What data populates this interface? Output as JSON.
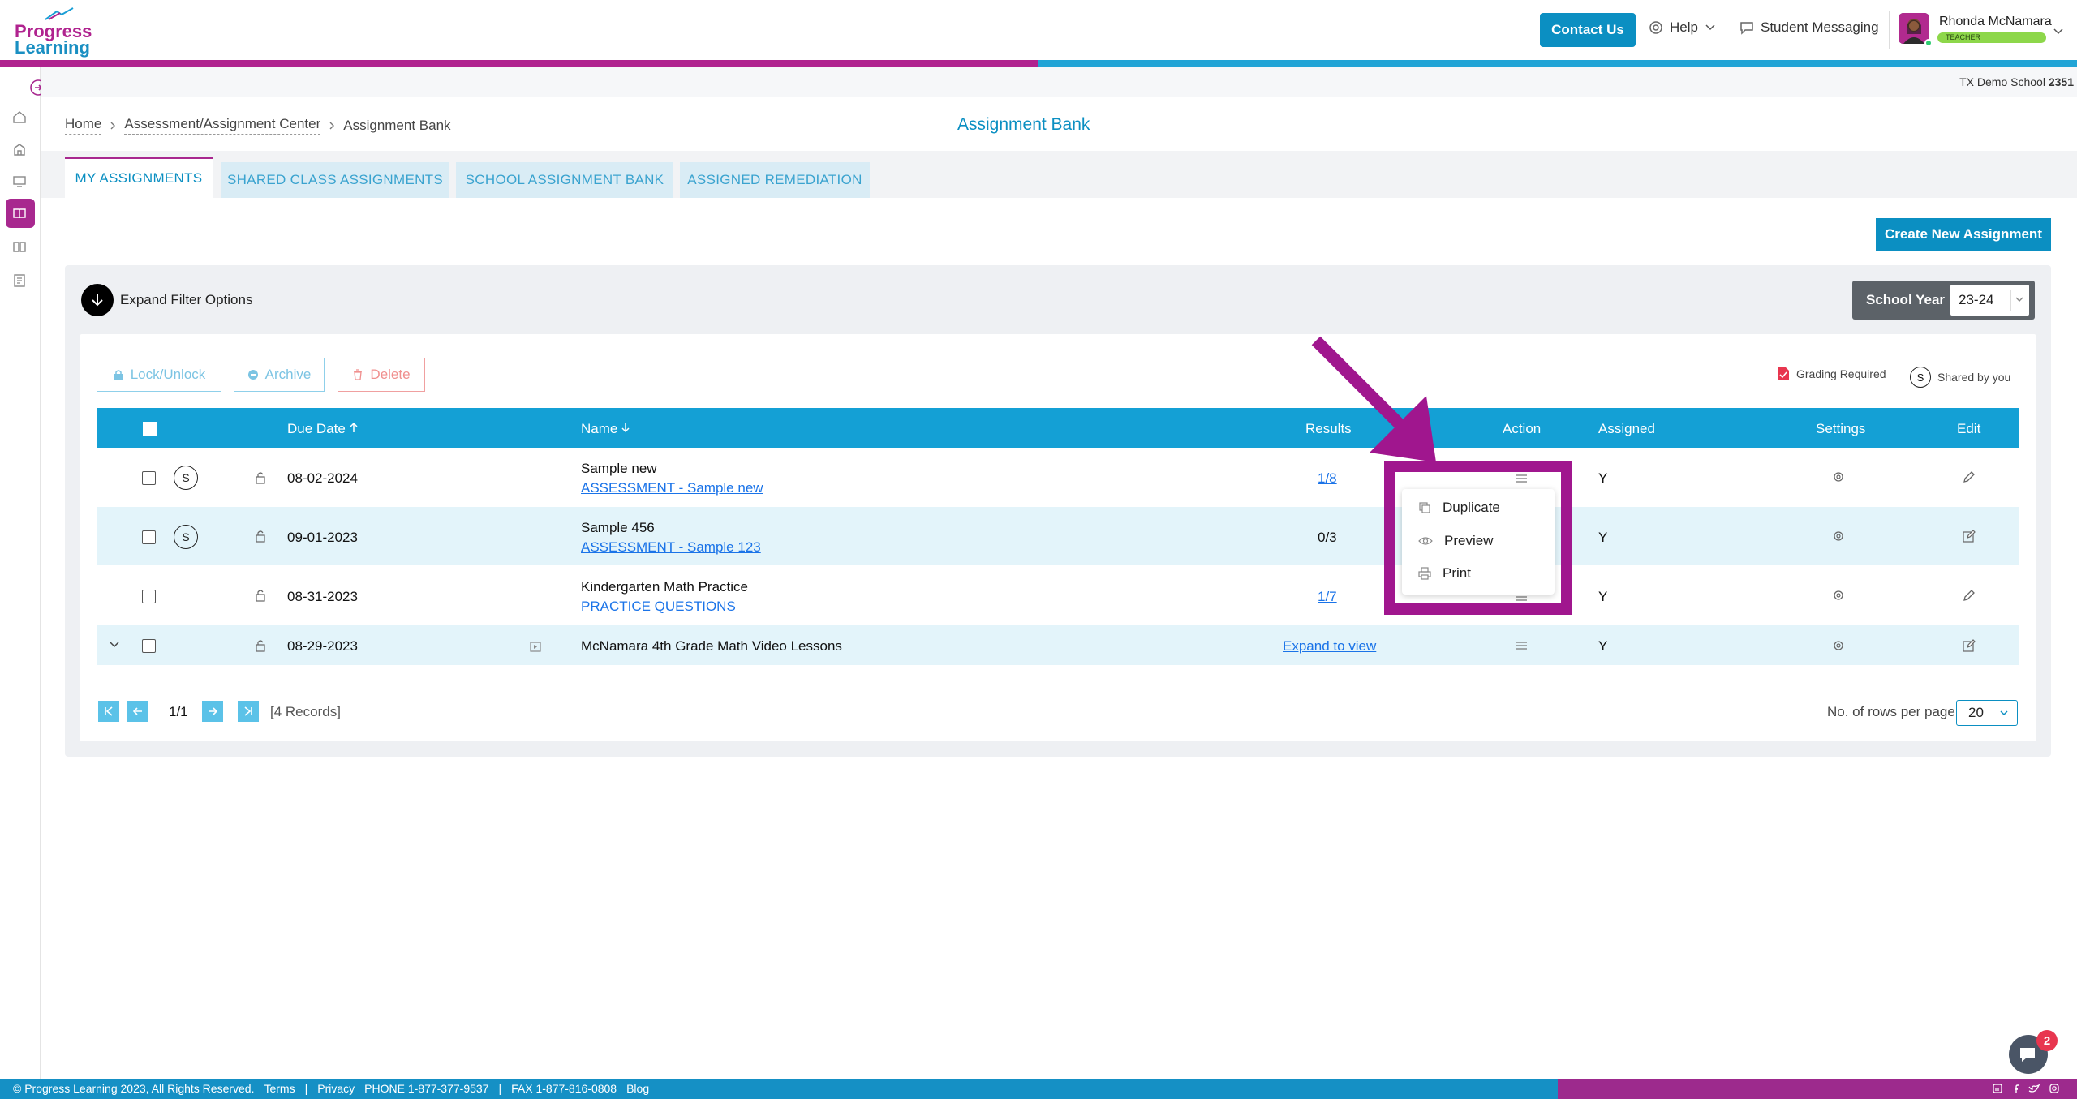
{
  "header": {
    "logo_line1": "Progress",
    "logo_line2": "Learning",
    "contact_label": "Contact Us",
    "help_label": "Help",
    "messaging_label": "Student Messaging",
    "user_name": "Rhonda McNamara",
    "user_role": "TEACHER"
  },
  "school": {
    "name": "TX Demo School",
    "id": "2351"
  },
  "breadcrumb": [
    "Home",
    "Assessment/Assignment Center",
    "Assignment Bank"
  ],
  "page_title": "Assignment Bank",
  "tabs": [
    "MY ASSIGNMENTS",
    "SHARED CLASS ASSIGNMENTS",
    "SCHOOL ASSIGNMENT BANK",
    "ASSIGNED REMEDIATION"
  ],
  "create_label": "Create New Assignment",
  "filter": {
    "expand_label": "Expand Filter Options",
    "school_year_label": "School Year",
    "school_year_value": "23-24"
  },
  "actions": {
    "lock": "Lock/Unlock",
    "archive": "Archive",
    "delete": "Delete"
  },
  "legend": {
    "grading": "Grading Required",
    "shared_symbol": "S",
    "shared": "Shared by you"
  },
  "columns": {
    "due_date": "Due Date",
    "name": "Name",
    "results": "Results",
    "action": "Action",
    "assigned": "Assigned",
    "settings": "Settings",
    "edit": "Edit"
  },
  "rows": [
    {
      "shared": "S",
      "due": "08-02-2024",
      "name": "Sample new",
      "sub": "ASSESSMENT - Sample new",
      "results": "1/8",
      "assigned": "Y"
    },
    {
      "shared": "S",
      "due": "09-01-2023",
      "name": "Sample 456",
      "sub": "ASSESSMENT - Sample 123",
      "results": "0/3",
      "assigned": "Y"
    },
    {
      "shared": "",
      "due": "08-31-2023",
      "name": "Kindergarten Math Practice",
      "sub": "PRACTICE QUESTIONS",
      "results": "1/7",
      "assigned": "Y"
    },
    {
      "shared": "",
      "due": "08-29-2023",
      "name": "McNamara 4th Grade Math Video Lessons",
      "sub": "",
      "results": "Expand to view",
      "assigned": "Y"
    }
  ],
  "context_menu": [
    "Duplicate",
    "Preview",
    "Print"
  ],
  "pagination": {
    "page": "1/1",
    "records": "[4 Records]",
    "rows_label": "No. of rows per page",
    "rows_value": "20"
  },
  "footer": {
    "copyright": "© Progress Learning 2023, All Rights Reserved.",
    "terms": "Terms",
    "sep": "|",
    "privacy": "Privacy",
    "phone": "PHONE 1-877-377-9537",
    "fax": "FAX 1-877-816-0808",
    "blog": "Blog"
  },
  "chat_badge": "2",
  "colors": {
    "brand_blue": "#0b8fc2",
    "brand_magenta": "#a8288f",
    "highlight": "#a0168e",
    "table_header": "#14a0d5"
  }
}
